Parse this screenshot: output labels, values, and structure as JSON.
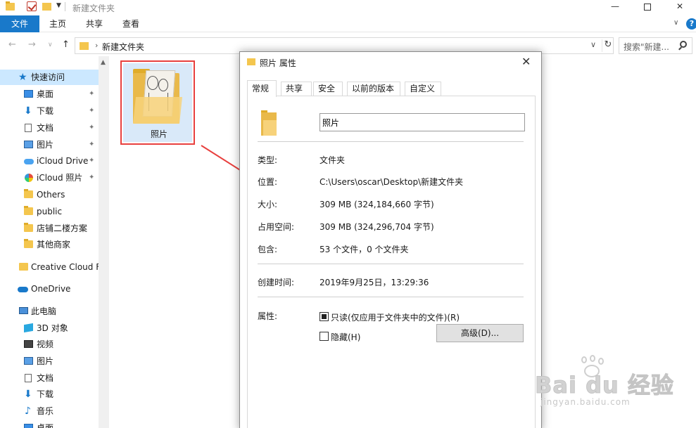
{
  "window": {
    "title": "新建文件夹",
    "controls": {
      "minimize": "—",
      "maximize": "",
      "close": "✕"
    }
  },
  "ribbon": {
    "tabs": [
      "文件",
      "主页",
      "共享",
      "查看"
    ],
    "collapse": "∨",
    "help": "?"
  },
  "address": {
    "back": "←",
    "forward": "→",
    "recent": "∨",
    "up": "↑",
    "separator": "›",
    "path": "新建文件夹",
    "dropdown": "∨",
    "refresh": "↻",
    "search_placeholder": "搜索\"新建..."
  },
  "nav": {
    "quick_access": "快速访问",
    "quick_items": [
      {
        "label": "桌面",
        "pinned": true,
        "icon": "desktop-icon"
      },
      {
        "label": "下载",
        "pinned": true,
        "icon": "download-icon"
      },
      {
        "label": "文档",
        "pinned": true,
        "icon": "document-icon"
      },
      {
        "label": "图片",
        "pinned": true,
        "icon": "picture-icon"
      },
      {
        "label": "iCloud Drive",
        "pinned": true,
        "icon": "icloud-icon"
      },
      {
        "label": "iCloud 照片",
        "pinned": true,
        "icon": "icloud-photos-icon"
      },
      {
        "label": "Others",
        "pinned": false,
        "icon": "folder-icon"
      },
      {
        "label": "public",
        "pinned": false,
        "icon": "folder-icon"
      },
      {
        "label": "店铺二楼方案",
        "pinned": false,
        "icon": "folder-icon"
      },
      {
        "label": "其他商家",
        "pinned": false,
        "icon": "folder-icon"
      }
    ],
    "creative_cloud": "Creative Cloud F",
    "onedrive": "OneDrive",
    "this_pc": "此电脑",
    "pc_items": [
      {
        "label": "3D 对象",
        "icon": "3d-objects-icon"
      },
      {
        "label": "视频",
        "icon": "video-icon"
      },
      {
        "label": "图片",
        "icon": "picture-icon"
      },
      {
        "label": "文档",
        "icon": "document-icon"
      },
      {
        "label": "下载",
        "icon": "download-icon"
      },
      {
        "label": "音乐",
        "icon": "music-icon"
      },
      {
        "label": "桌面",
        "icon": "desktop-icon"
      }
    ],
    "pin_glyph": "📌"
  },
  "content": {
    "folder_name": "照片"
  },
  "dialog": {
    "title": "照片 属性",
    "close": "✕",
    "tabs": [
      "常规",
      "共享",
      "安全",
      "以前的版本",
      "自定义"
    ],
    "active_tab": "常规",
    "name_value": "照片",
    "props": [
      {
        "label": "类型:",
        "value": "文件夹"
      },
      {
        "label": "位置:",
        "value": "C:\\Users\\oscar\\Desktop\\新建文件夹"
      },
      {
        "label": "大小:",
        "value": "309 MB (324,184,660 字节)"
      },
      {
        "label": "占用空间:",
        "value": "309 MB (324,296,704 字节)"
      },
      {
        "label": "包含:",
        "value": "53 个文件，0 个文件夹"
      }
    ],
    "created_label": "创建时间:",
    "created_value": "2019年9月25日，13:29:36",
    "attributes_label": "属性:",
    "readonly_label": "只读(仅应用于文件夹中的文件)(R)",
    "readonly_checked": true,
    "hidden_label": "隐藏(H)",
    "hidden_checked": false,
    "advanced_button": "高级(D)..."
  },
  "watermark": {
    "brand": "Bai du 经验",
    "sub": "jingyan.baidu.com"
  },
  "colors": {
    "accent": "#1979ca",
    "highlight_border": "#e8403e",
    "selection": "#cce8ff"
  }
}
